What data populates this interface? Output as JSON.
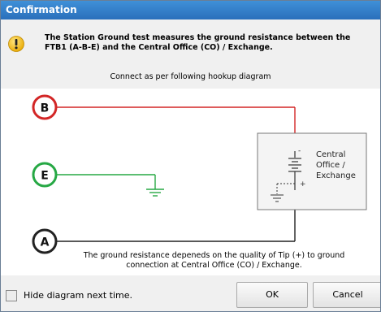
{
  "window": {
    "title": "Confirmation"
  },
  "message": {
    "line1": "The Station Ground test measures the ground resistance between the",
    "line2": "FTB1 (A-B-E) and the Central Office (CO) / Exchange."
  },
  "diagram": {
    "instruction": "Connect as per following hookup diagram",
    "terminals": [
      "B",
      "E",
      "A"
    ],
    "terminal_colors": {
      "B": "#d32626",
      "E": "#26a844",
      "A": "#222222"
    },
    "central_office_label": [
      "Central",
      "Office /",
      "Exchange"
    ],
    "minus_sign": "-",
    "plus_sign": "+",
    "footnote": {
      "line1": "The ground resistance depeneds on the quality of Tip (+) to ground",
      "line2": "connection at Central Office (CO) / Exchange."
    }
  },
  "footer": {
    "checkbox_label": "Hide diagram next time.",
    "checkbox_checked": false,
    "ok_label": "OK",
    "cancel_label": "Cancel"
  },
  "icons": {
    "warning": "warning-icon"
  }
}
